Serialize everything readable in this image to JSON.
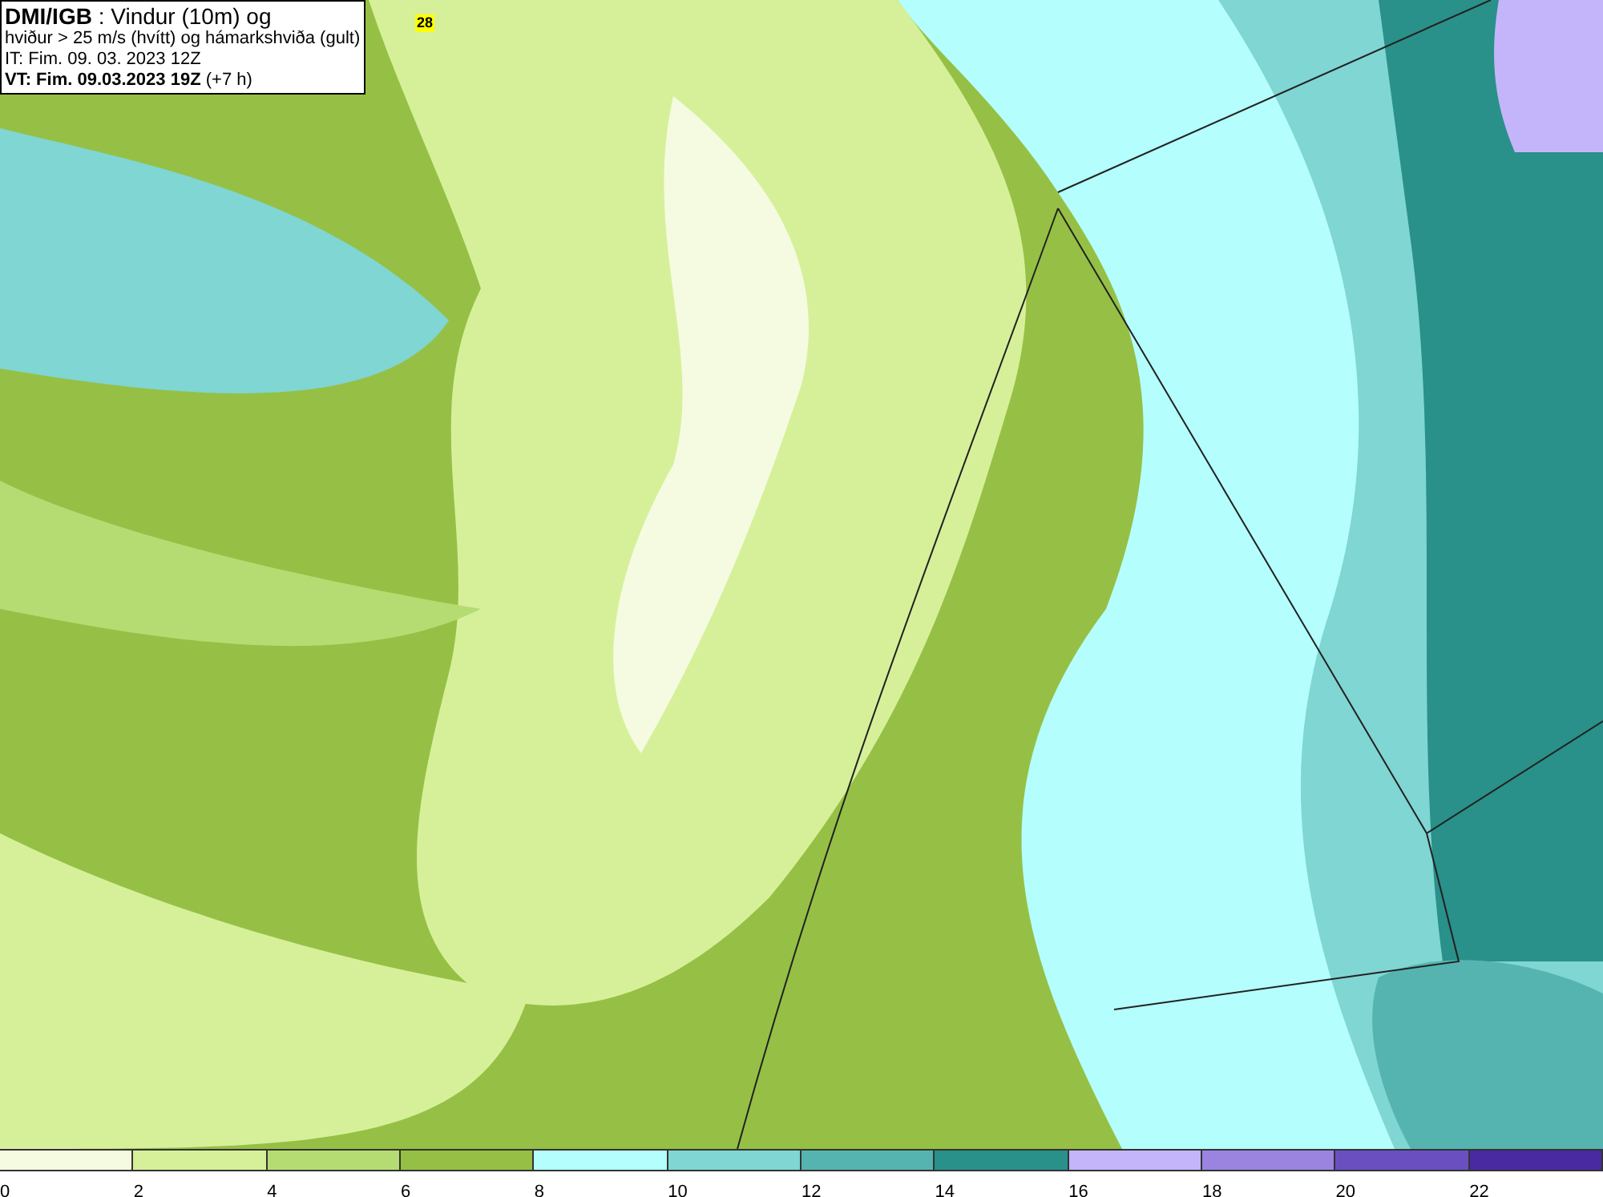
{
  "header": {
    "lines": [
      "**DMI/IGB** : Vindur (10m) og",
      "hviður > 25 m/s (hvítt) og hámarkshviða (gult)",
      "IT: Fim. 09. 03. 2023 12Z",
      "**VT: Fim. 09.03.2023 19Z** (+7 h)"
    ]
  },
  "max_gust_marker": "28",
  "legend": [
    {
      "color": "#f5fbe0",
      "label": "0"
    },
    {
      "color": "#d6f09a",
      "label": "2"
    },
    {
      "color": "#b5dc72",
      "label": "4"
    },
    {
      "color": "#96c045",
      "label": "6"
    },
    {
      "color": "#b4fffd",
      "label": "8"
    },
    {
      "color": "#7fd6d3",
      "label": "10"
    },
    {
      "color": "#56b4b0",
      "label": "12"
    },
    {
      "color": "#2a908a",
      "label": "14"
    },
    {
      "color": "#c4b5fb",
      "label": "16"
    },
    {
      "color": "#9a84e0",
      "label": "18"
    },
    {
      "color": "#6a4fc0",
      "label": "20"
    },
    {
      "color": "#4a2aa0",
      "label": "22"
    }
  ]
}
